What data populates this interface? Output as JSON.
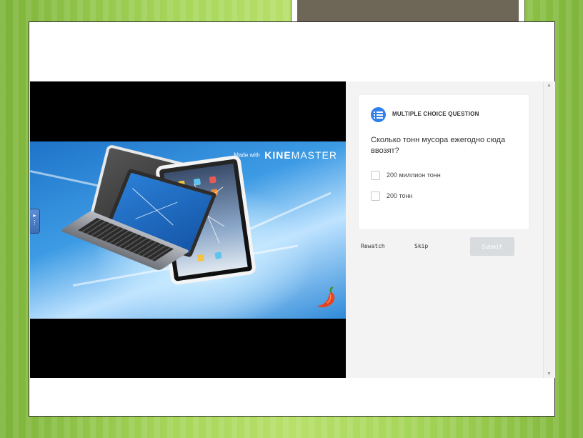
{
  "slide": {
    "video": {
      "watermark_prefix": "Made with",
      "watermark_brand_bold": "KINE",
      "watermark_brand_rest": "MASTER"
    },
    "question": {
      "type_label": "MULTIPLE CHOICE QUESTION",
      "type_icon": "list-icon",
      "text": "Сколько тонн мусора ежегодно сюда ввозят?",
      "options": [
        {
          "label": "200 миллион тонн",
          "checked": false
        },
        {
          "label": "200 тонн",
          "checked": false
        }
      ]
    },
    "actions": {
      "rewatch_label": "Rewatch",
      "skip_label": "Skip",
      "submit_label": "Submit"
    },
    "colors": {
      "accent": "#2f80ed",
      "submit_disabled": "#d9dcdf"
    }
  }
}
